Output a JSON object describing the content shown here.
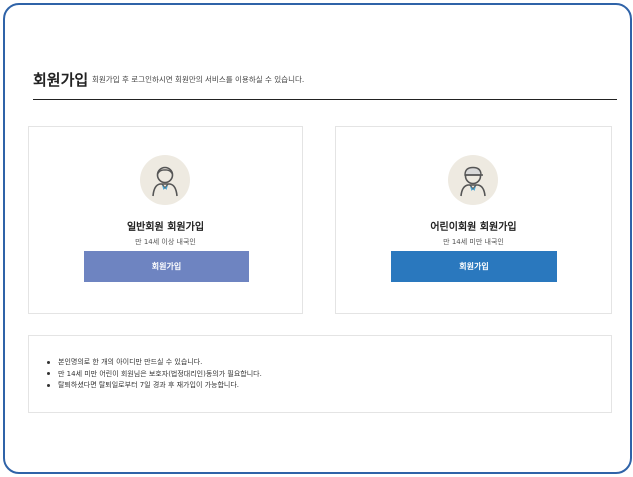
{
  "header": {
    "title": "회원가입",
    "subtitle": "회원가입 후 로그인하시면 회원만의 서비스를 이용하실 수 있습니다."
  },
  "cards": [
    {
      "icon": "adult-user-icon",
      "title": "일반회원 회원가입",
      "description": "만 14세 이상 내국인",
      "button_label": "회원가입",
      "button_color": "#6e84c1"
    },
    {
      "icon": "child-user-icon",
      "title": "어린이회원 회원가입",
      "description": "만 14세 미만 내국인",
      "button_label": "회원가입",
      "button_color": "#2a78be"
    }
  ],
  "notice": {
    "items": [
      "본인명의로 한 개의 아이디만 만드실 수 있습니다.",
      "만 14세 미만 어린이 회원님은 보호자(법정대리인)동의가 필요합니다.",
      "탈퇴하셨다면 탈퇴일로부터 7일 경과 후 재가입이 가능합니다."
    ]
  },
  "colors": {
    "frame_border": "#2f63a8",
    "avatar_bg": "#eeeae1"
  }
}
